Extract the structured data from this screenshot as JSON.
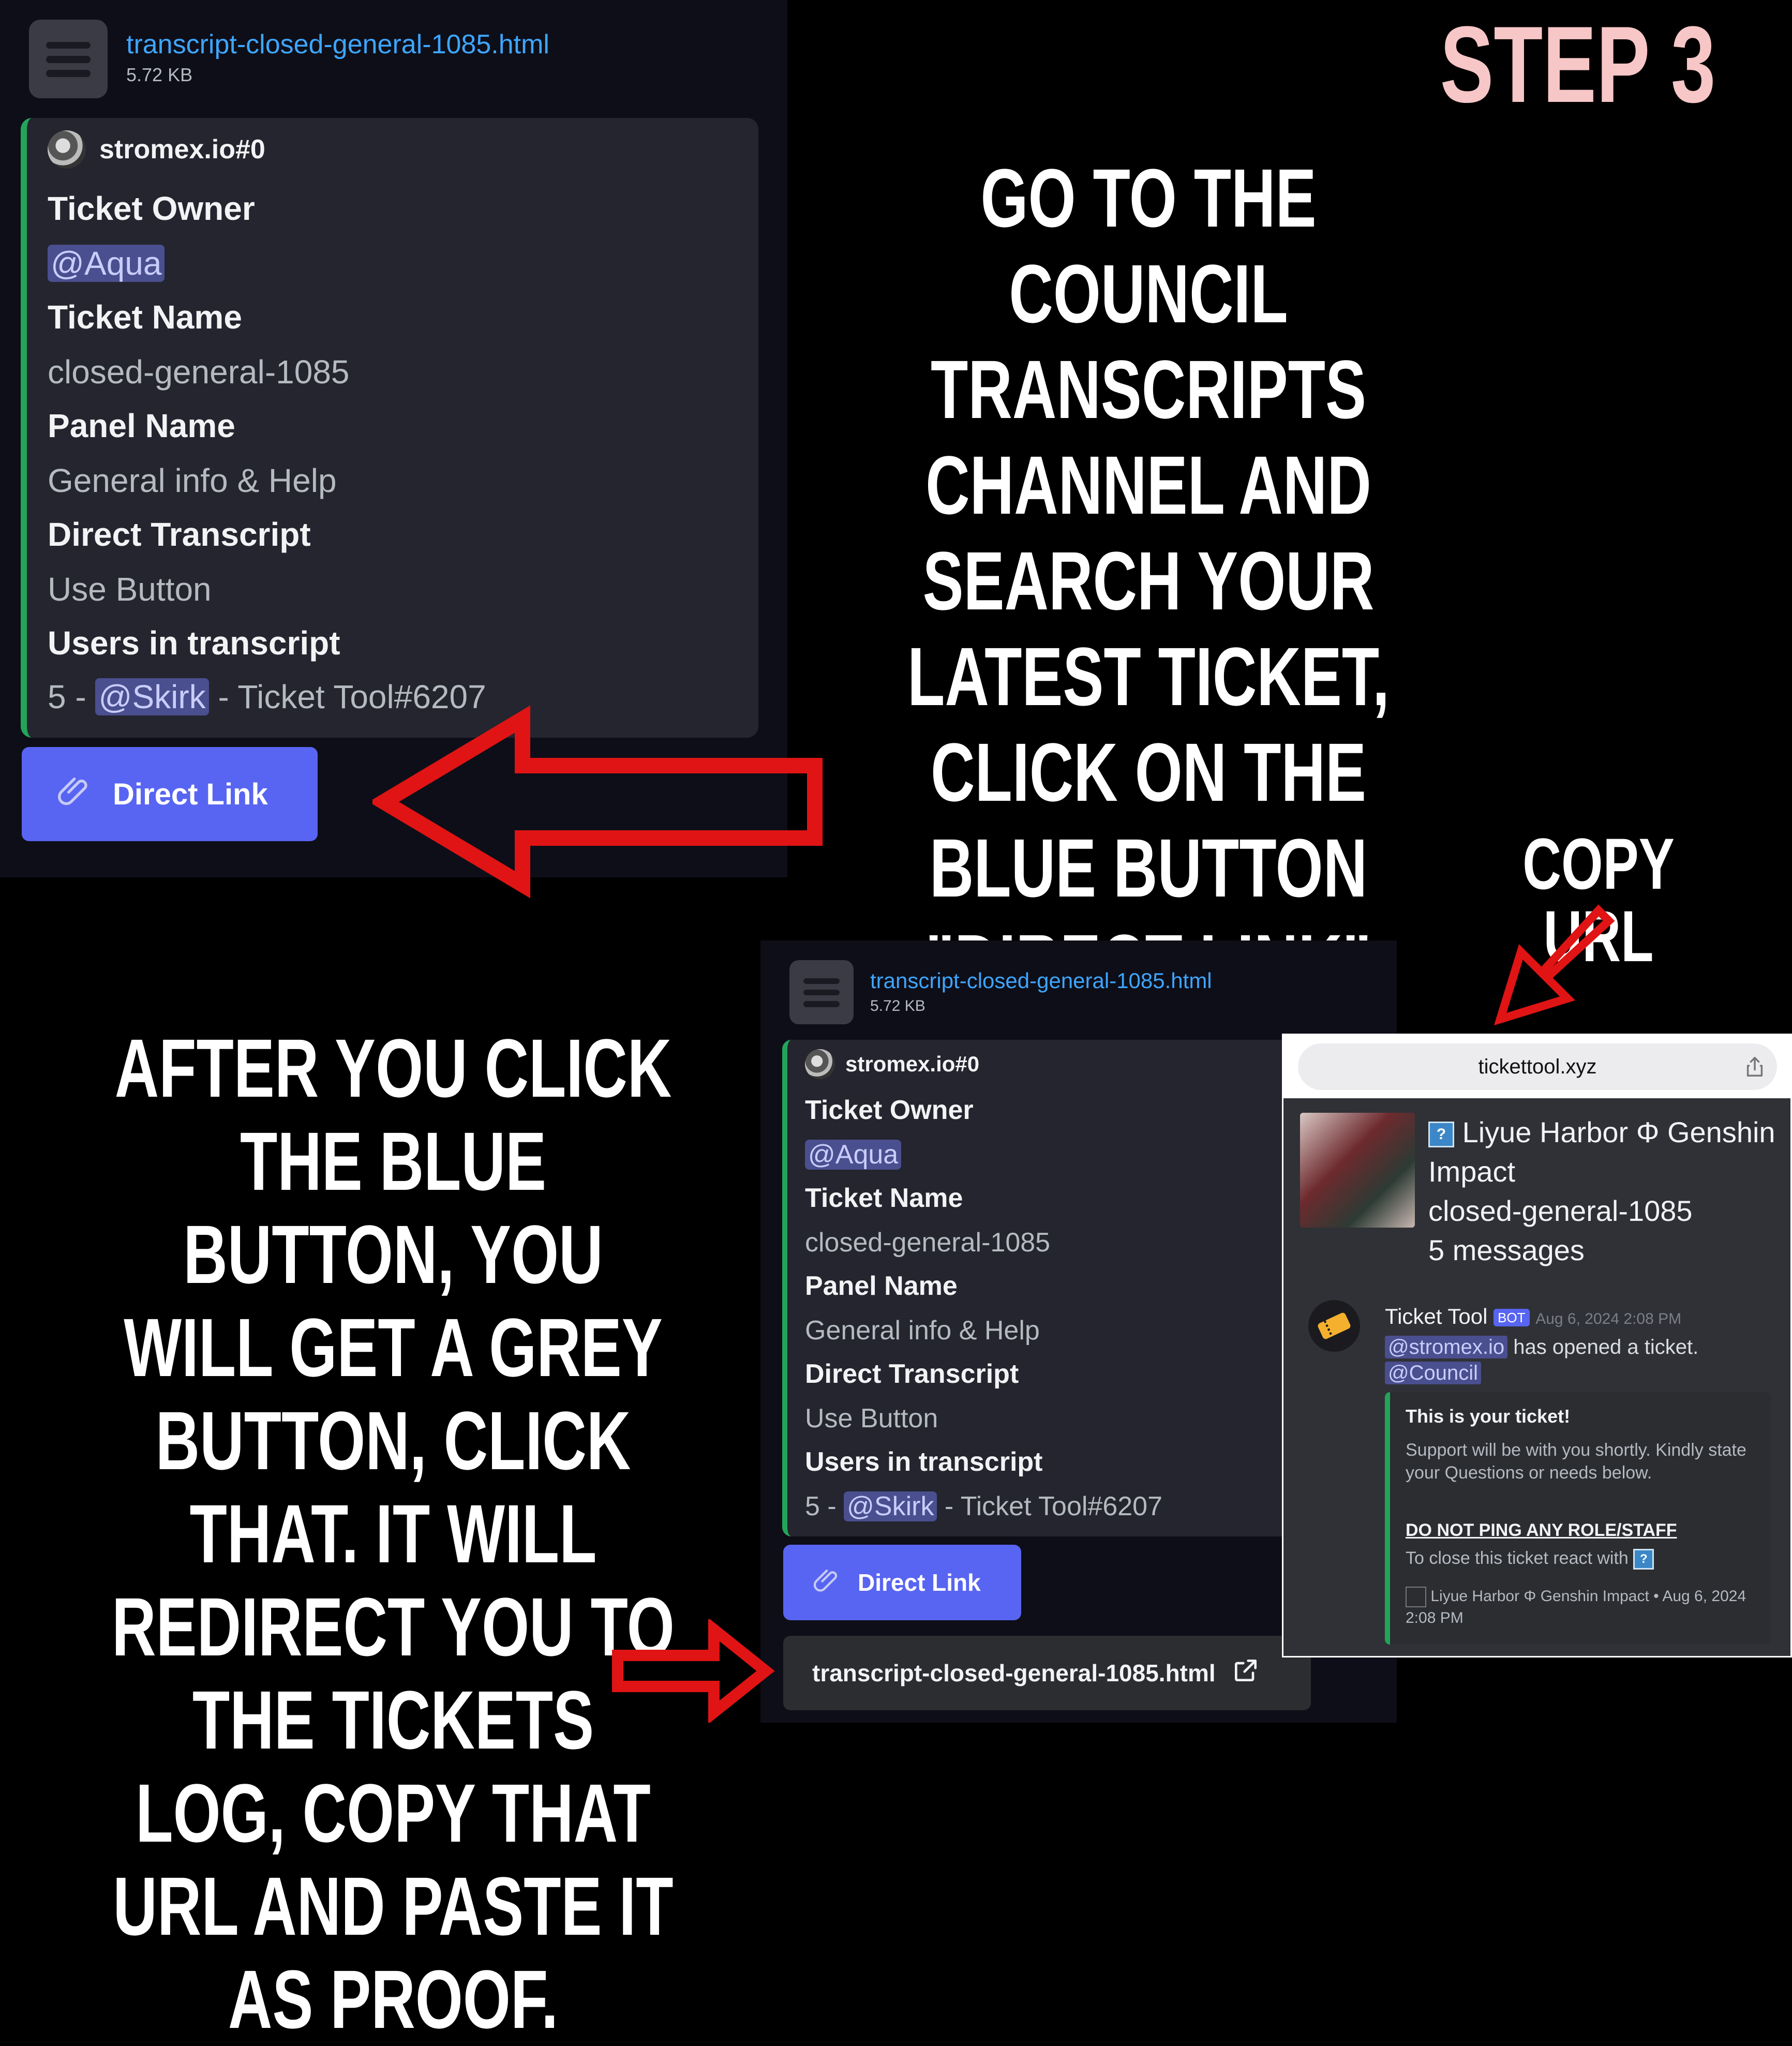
{
  "headings": {
    "step": "STEP 3",
    "instruction_1": "GO TO THE COUNCIL TRANSCRIPTS CHANNEL AND SEARCH YOUR LATEST TICKET, CLICK ON THE BLUE BUTTON \"DIRECT LINK\"",
    "instruction_2": "AFTER YOU CLICK THE BLUE BUTTON, YOU WILL GET A GREY BUTTON, CLICK THAT. IT WILL REDIRECT YOU TO THE TICKETS LOG, COPY THAT URL AND PASTE IT AS PROOF.",
    "copy_url": "COPY URL"
  },
  "attachment": {
    "file_name": "transcript-closed-general-1085.html",
    "file_size": "5.72 KB"
  },
  "embed": {
    "author": "stromex.io#0",
    "fields": [
      {
        "name": "Ticket Owner",
        "mention": "@Aqua"
      },
      {
        "name": "Ticket Name",
        "value": "closed-general-1085"
      },
      {
        "name": "Panel Name",
        "value": "General info & Help"
      },
      {
        "name": "Direct Transcript",
        "value": "Use Button"
      },
      {
        "name": "Users in transcript",
        "prefix": "5 - ",
        "mention": "@Skirk",
        "suffix": " - Ticket Tool#6207"
      }
    ]
  },
  "buttons": {
    "direct_link": "Direct Link",
    "transcript_file": "transcript-closed-general-1085.html"
  },
  "browser": {
    "url": "tickettool.xyz",
    "server_name": "Liyue Harbor Φ Genshin Impact",
    "ticket_name": "closed-general-1085",
    "message_count": "5 messages",
    "icon_glyph": "?",
    "bot_name": "Ticket Tool",
    "bot_badge": "BOT",
    "timestamp": "Aug 6, 2024 2:08 PM",
    "mention_user": "@stromex.io",
    "opened_text": " has opened a ticket.",
    "mention_role": "@Council",
    "embed_title": "This is your ticket!",
    "embed_desc": "Support will be with you shortly. Kindly state your Questions or needs below.",
    "embed_warning": "DO NOT PING ANY ROLE/STAFF",
    "embed_close": "To close this ticket react with",
    "embed_footer": "Liyue Harbor Φ Genshin Impact • Aug 6, 2024 2:08 PM"
  },
  "colors": {
    "blurple": "#5865f2",
    "embed_accent": "#23a559",
    "link": "#3ea6ff",
    "arrow": "#e01414",
    "step_title": "#f7c6c6"
  }
}
